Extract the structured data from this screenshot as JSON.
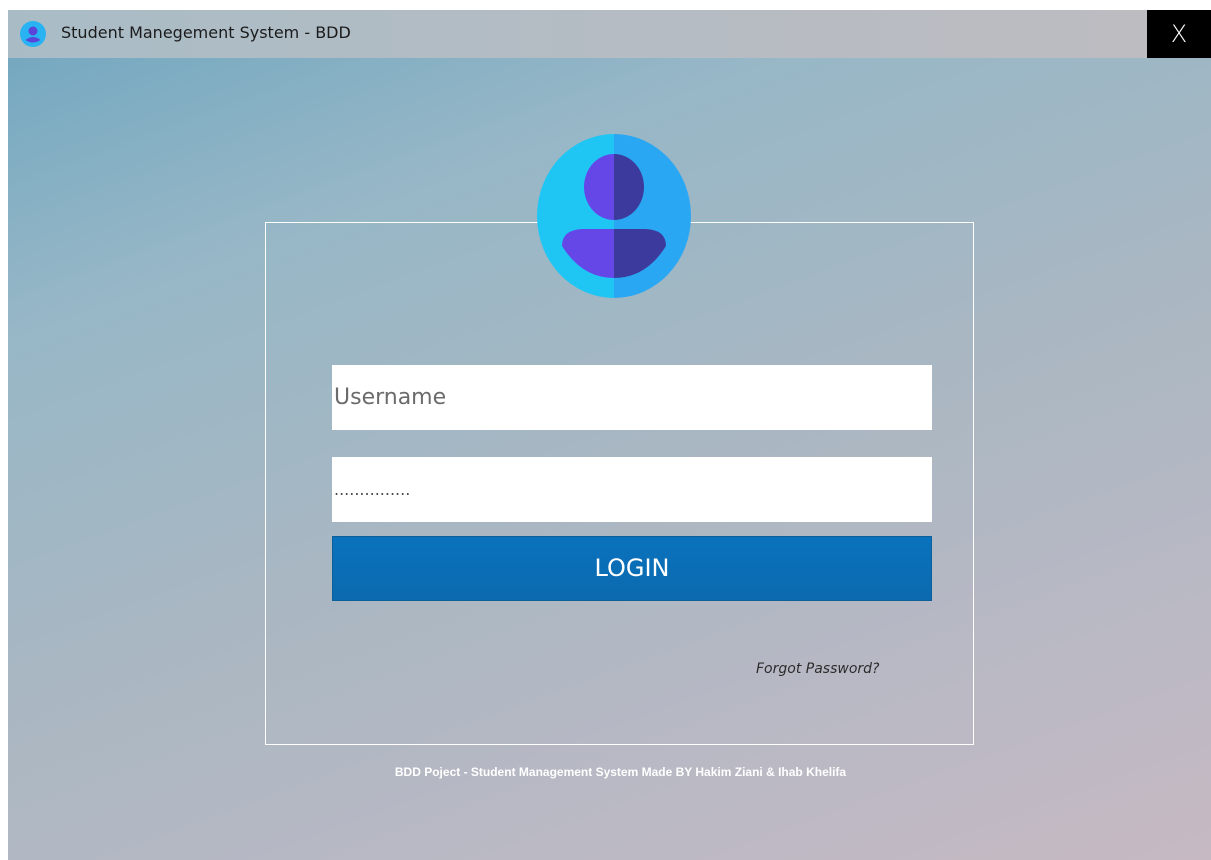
{
  "window": {
    "title": "Student Manegement System - BDD",
    "close_label": "X"
  },
  "login": {
    "username_placeholder": "Username",
    "password_value": "...............",
    "login_label": "LOGIN",
    "forgot_label": "Forgot Password?"
  },
  "footer": {
    "text": "BDD Poject - Student Management System Made BY Hakim Ziani & Ihab Khelifa"
  },
  "icons": {
    "app_icon": "user-icon",
    "avatar": "user-avatar-icon"
  },
  "colors": {
    "login_button": "#0a72bd",
    "avatar_left": "#1fc6f4",
    "avatar_right": "#2aa7f3",
    "person_left": "#6547e8",
    "person_right": "#3d3a9e"
  }
}
